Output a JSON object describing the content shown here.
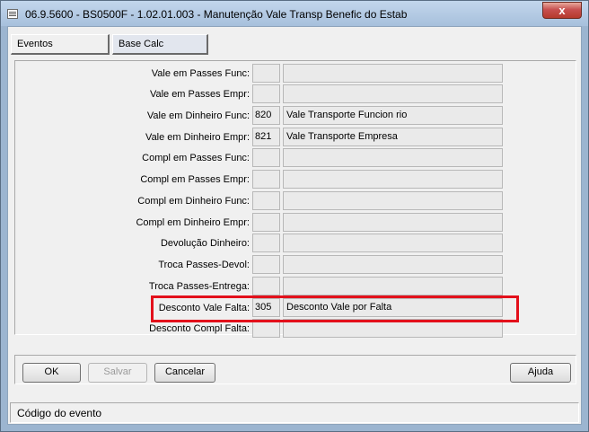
{
  "window": {
    "title": "06.9.5600 - BS0500F - 1.02.01.003 - Manutenção Vale Transp Benefic do Estab",
    "close_glyph": "x"
  },
  "tabs": [
    {
      "label": "Eventos"
    },
    {
      "label": "Base Calc"
    }
  ],
  "fields": [
    {
      "label": "Vale em Passes Func:",
      "code": "",
      "desc": ""
    },
    {
      "label": "Vale em Passes Empr:",
      "code": "",
      "desc": ""
    },
    {
      "label": "Vale em Dinheiro Func:",
      "code": "820",
      "desc": "Vale Transporte Funcion rio"
    },
    {
      "label": "Vale em Dinheiro Empr:",
      "code": "821",
      "desc": "Vale Transporte Empresa"
    },
    {
      "label": "Compl em Passes Func:",
      "code": "",
      "desc": ""
    },
    {
      "label": "Compl em Passes Empr:",
      "code": "",
      "desc": ""
    },
    {
      "label": "Compl em Dinheiro Func:",
      "code": "",
      "desc": ""
    },
    {
      "label": "Compl em Dinheiro Empr:",
      "code": "",
      "desc": ""
    },
    {
      "label": "Devolução Dinheiro:",
      "code": "",
      "desc": ""
    },
    {
      "label": "Troca Passes-Devol:",
      "code": "",
      "desc": ""
    },
    {
      "label": "Troca Passes-Entrega:",
      "code": "",
      "desc": ""
    },
    {
      "label": "Desconto Vale Falta:",
      "code": "305",
      "desc": "Desconto Vale por Falta"
    },
    {
      "label": "Desconto Compl Falta:",
      "code": "",
      "desc": ""
    }
  ],
  "buttons": {
    "ok": "OK",
    "salvar": "Salvar",
    "cancelar": "Cancelar",
    "ajuda": "Ajuda"
  },
  "status": {
    "text": "Código do evento"
  },
  "colors": {
    "highlight": "#e3101b"
  }
}
